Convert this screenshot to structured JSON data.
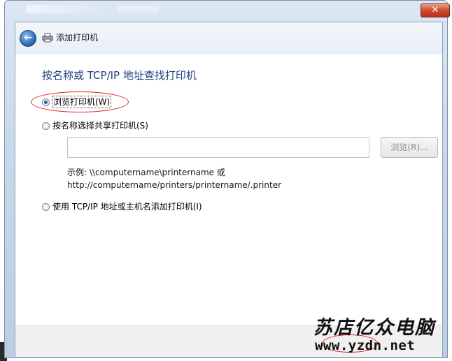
{
  "window": {
    "close_label": "✕"
  },
  "nav": {
    "back_label": "←",
    "title": "添加打印机"
  },
  "main": {
    "heading": "按名称或 TCP/IP 地址查找打印机",
    "options": [
      {
        "label": "浏览打印机(W)",
        "checked": true
      },
      {
        "label": "按名称选择共享打印机(S)",
        "checked": false
      },
      {
        "label": "使用 TCP/IP 地址或主机名添加打印机(I)",
        "checked": false
      }
    ],
    "name_input": {
      "value": "",
      "placeholder": ""
    },
    "browse_button": "浏览(R)...",
    "example_line1": "示例: \\\\computername\\printername 或",
    "example_line2": "http://computername/printers/printername/.printer"
  },
  "watermark": {
    "line1": "苏店亿众电脑",
    "line2": "www.yzdn.net"
  },
  "colors": {
    "heading": "#1f3f7a",
    "annotation": "#dd2222"
  }
}
